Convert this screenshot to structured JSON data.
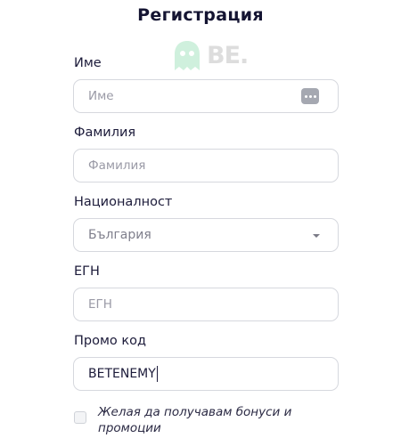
{
  "form": {
    "title": "Регистрация",
    "first_name": {
      "label": "Име",
      "placeholder": "Име"
    },
    "last_name": {
      "label": "Фамилия",
      "placeholder": "Фамилия"
    },
    "nationality": {
      "label": "Националност",
      "selected": "България"
    },
    "egn": {
      "label": "ЕГН",
      "placeholder": "ЕГН"
    },
    "promo": {
      "label": "Промо код",
      "value": "BETENEMY"
    },
    "bonus_opt_in": {
      "label": "Желая да получавам бонуси и промоции",
      "checked": false
    }
  },
  "watermark": {
    "text": "BE."
  },
  "colors": {
    "text": "#1c1b3a",
    "border": "#d6d8de",
    "placeholder": "#9a9aa6"
  }
}
